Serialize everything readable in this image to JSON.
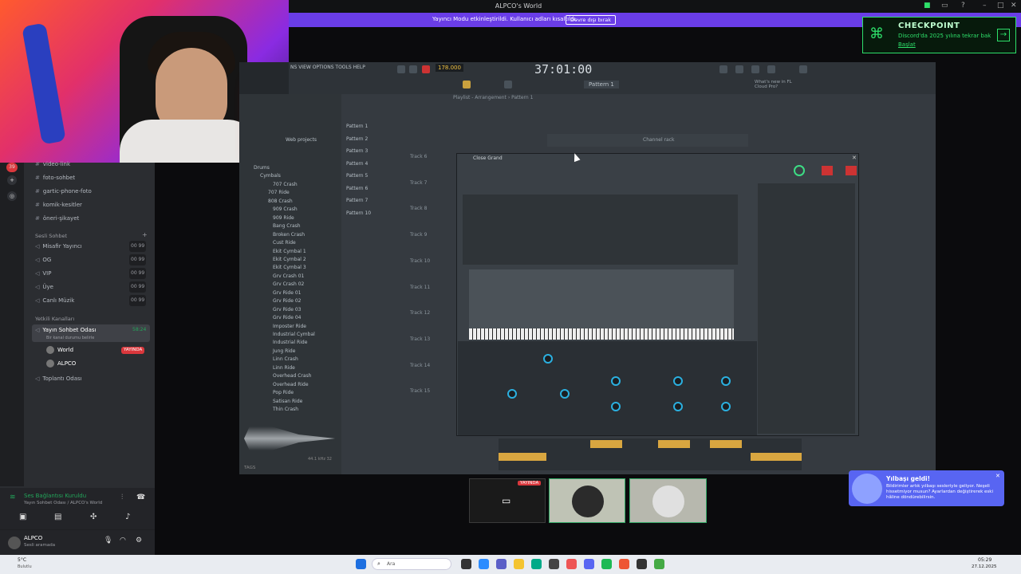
{
  "window": {
    "title": "ALPCO's World"
  },
  "banner": {
    "text": "Yayıncı Modu etkinleştirildi. Kullanıcı adları kısaltıldı.",
    "button": "Devre dışı bırak"
  },
  "checkpoint": {
    "heading": "CHECKPOINT",
    "subtitle": "Discord'da 2025 yılına tekrar bak",
    "link": "Başlat"
  },
  "sidebar": {
    "text_channels": [
      "video-link",
      "foto-sohbet",
      "gartic-phone-foto",
      "komik-kesitler",
      "öneri-şikayet"
    ],
    "voice_category": "Sesli Sohbet",
    "voice_channels": [
      {
        "label": "Misafir Yayıncı",
        "count": "00 99"
      },
      {
        "label": "OG",
        "count": "00 99"
      },
      {
        "label": "VIP",
        "count": "00 99"
      },
      {
        "label": "Üye",
        "count": "00 99"
      },
      {
        "label": "Canlı Müzik",
        "count": "00 99"
      }
    ],
    "auth_category": "Yetkili Kanalları",
    "active_channel": "Yayın Sohbet Odası",
    "active_channel_time": "58:24",
    "active_channel_status": "Bir kanal durumu belirle",
    "users": [
      {
        "name": "World",
        "badge": "YAYINDA"
      },
      {
        "name": "ALPCO",
        "badge": ""
      }
    ],
    "meeting_room": "Toplantı Odası",
    "badge_count": "39"
  },
  "voice": {
    "status": "Ses Bağlantısı Kuruldu",
    "location": "Yayın Sohbet Odası / ALPCO's World"
  },
  "user": {
    "name": "ALPCO",
    "status": "Sesli aramada"
  },
  "fl": {
    "menu": "NS VIEW OPTIONS TOOLS HELP",
    "tempo": "178.000",
    "time": "37:01:00",
    "pattern": "Pattern 1",
    "playlist_title": "Playlist - Arrangement › Pattern 1",
    "hint": "What's new in FL Cloud Pro?",
    "web_projects": "Web projects",
    "browser": [
      "Drums",
      "Cymbals",
      "707 Crash",
      "707 Ride",
      "808 Crash",
      "909 Crash",
      "909 Ride",
      "Bang Crash",
      "Broken Crash",
      "Cust Ride",
      "Ekit Cymbal 1",
      "Ekit Cymbal 2",
      "Ekit Cymbal 3",
      "Grv Crash 01",
      "Grv Crash 02",
      "Grv Ride 01",
      "Grv Ride 02",
      "Grv Ride 03",
      "Grv Ride 04",
      "Imposter Ride",
      "Industrial Cymbal",
      "Industrial Ride",
      "Jung Ride",
      "Linn Crash",
      "Linn Ride",
      "Overhead Crash",
      "Overhead Ride",
      "Pop Ride",
      "Satisan Ride",
      "Thin Crash"
    ],
    "patterns": [
      "Pattern 1",
      "Pattern 2",
      "Pattern 3",
      "Pattern 4",
      "Pattern 5",
      "Pattern 6",
      "Pattern 7",
      "Pattern 10"
    ],
    "tracks": [
      "Track 6",
      "Track 7",
      "Track 8",
      "Track 9",
      "Track 10",
      "Track 11",
      "Track 12",
      "Track 13",
      "Track 14",
      "Track 15"
    ],
    "channel_window": "Close Grand",
    "channel_rack": "Channel rack",
    "sample_rate": "44.1 kHz 32",
    "tags": "TAGS"
  },
  "notification": {
    "title": "Yılbaşı geldi!",
    "body": "Bildirimler artık yılbaşı sesleriyle geliyor. Neşeli hissetmiyor musun? Ayarlardan değiştirerek eski hâline döndürebilirsin."
  },
  "stream": {
    "live_badge": "YAYINDA"
  },
  "taskbar": {
    "weather_temp": "5°C",
    "weather_desc": "Bulutlu",
    "search_placeholder": "Ara",
    "time": "05:29",
    "date": "27.12.2025"
  },
  "colors": {
    "accent": "#6a3de8",
    "discord_bg": "#2b2d31",
    "checkpoint_green": "#2ee06a"
  }
}
